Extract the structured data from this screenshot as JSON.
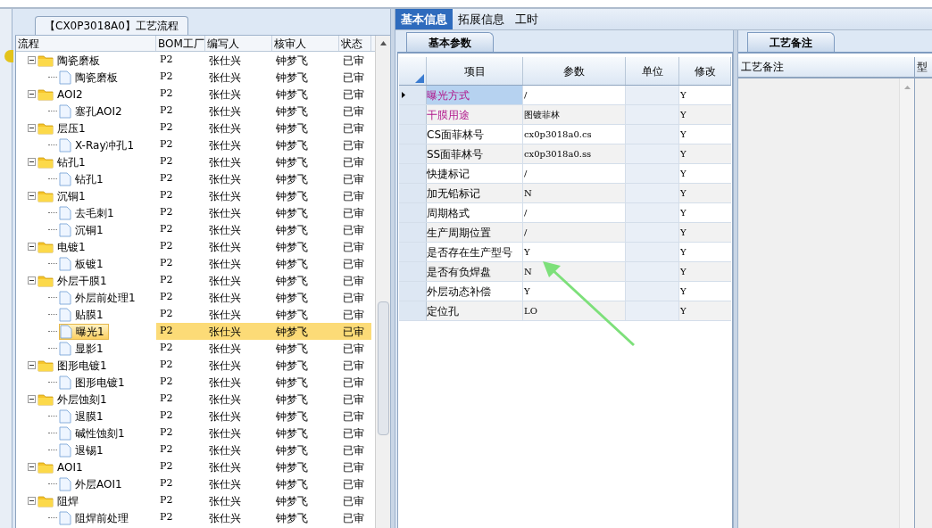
{
  "flow_panel": {
    "title": "【CX0P3018A0】工艺流程",
    "columns": [
      "流程",
      "BOM工厂",
      "编写人",
      "核审人",
      "状态"
    ],
    "tree": [
      {
        "label": "陶瓷磨板",
        "bom": "P2",
        "writer": "张仕兴",
        "reviewer": "钟梦飞",
        "status": "已审",
        "expanded": true,
        "selected": false,
        "children": [
          {
            "label": "陶瓷磨板",
            "bom": "P2",
            "writer": "张仕兴",
            "reviewer": "钟梦飞",
            "status": "已审",
            "selected": false
          }
        ]
      },
      {
        "label": "AOI2",
        "bom": "P2",
        "writer": "张仕兴",
        "reviewer": "钟梦飞",
        "status": "已审",
        "expanded": true,
        "selected": false,
        "children": [
          {
            "label": "塞孔AOI2",
            "bom": "P2",
            "writer": "张仕兴",
            "reviewer": "钟梦飞",
            "status": "已审",
            "selected": false
          }
        ]
      },
      {
        "label": "层压1",
        "bom": "P2",
        "writer": "张仕兴",
        "reviewer": "钟梦飞",
        "status": "已审",
        "expanded": true,
        "selected": false,
        "children": [
          {
            "label": "X-Ray冲孔1",
            "bom": "P2",
            "writer": "张仕兴",
            "reviewer": "钟梦飞",
            "status": "已审",
            "selected": false
          }
        ]
      },
      {
        "label": "钻孔1",
        "bom": "P2",
        "writer": "张仕兴",
        "reviewer": "钟梦飞",
        "status": "已审",
        "expanded": true,
        "selected": false,
        "children": [
          {
            "label": "钻孔1",
            "bom": "P2",
            "writer": "张仕兴",
            "reviewer": "钟梦飞",
            "status": "已审",
            "selected": false
          }
        ]
      },
      {
        "label": "沉铜1",
        "bom": "P2",
        "writer": "张仕兴",
        "reviewer": "钟梦飞",
        "status": "已审",
        "expanded": true,
        "selected": false,
        "children": [
          {
            "label": "去毛刺1",
            "bom": "P2",
            "writer": "张仕兴",
            "reviewer": "钟梦飞",
            "status": "已审",
            "selected": false
          },
          {
            "label": "沉铜1",
            "bom": "P2",
            "writer": "张仕兴",
            "reviewer": "钟梦飞",
            "status": "已审",
            "selected": false
          }
        ]
      },
      {
        "label": "电镀1",
        "bom": "P2",
        "writer": "张仕兴",
        "reviewer": "钟梦飞",
        "status": "已审",
        "expanded": true,
        "selected": false,
        "children": [
          {
            "label": "板镀1",
            "bom": "P2",
            "writer": "张仕兴",
            "reviewer": "钟梦飞",
            "status": "已审",
            "selected": false
          }
        ]
      },
      {
        "label": "外层干膜1",
        "bom": "P2",
        "writer": "张仕兴",
        "reviewer": "钟梦飞",
        "status": "已审",
        "expanded": true,
        "selected": false,
        "children": [
          {
            "label": "外层前处理1",
            "bom": "P2",
            "writer": "张仕兴",
            "reviewer": "钟梦飞",
            "status": "已审",
            "selected": false
          },
          {
            "label": "贴膜1",
            "bom": "P2",
            "writer": "张仕兴",
            "reviewer": "钟梦飞",
            "status": "已审",
            "selected": false
          },
          {
            "label": "曝光1",
            "bom": "P2",
            "writer": "张仕兴",
            "reviewer": "钟梦飞",
            "status": "已审",
            "selected": true
          },
          {
            "label": "显影1",
            "bom": "P2",
            "writer": "张仕兴",
            "reviewer": "钟梦飞",
            "status": "已审",
            "selected": false
          }
        ]
      },
      {
        "label": "图形电镀1",
        "bom": "P2",
        "writer": "张仕兴",
        "reviewer": "钟梦飞",
        "status": "已审",
        "expanded": true,
        "selected": false,
        "children": [
          {
            "label": "图形电镀1",
            "bom": "P2",
            "writer": "张仕兴",
            "reviewer": "钟梦飞",
            "status": "已审",
            "selected": false
          }
        ]
      },
      {
        "label": "外层蚀刻1",
        "bom": "P2",
        "writer": "张仕兴",
        "reviewer": "钟梦飞",
        "status": "已审",
        "expanded": true,
        "selected": false,
        "children": [
          {
            "label": "退膜1",
            "bom": "P2",
            "writer": "张仕兴",
            "reviewer": "钟梦飞",
            "status": "已审",
            "selected": false
          },
          {
            "label": "碱性蚀刻1",
            "bom": "P2",
            "writer": "张仕兴",
            "reviewer": "钟梦飞",
            "status": "已审",
            "selected": false
          },
          {
            "label": "退锡1",
            "bom": "P2",
            "writer": "张仕兴",
            "reviewer": "钟梦飞",
            "status": "已审",
            "selected": false
          }
        ]
      },
      {
        "label": "AOI1",
        "bom": "P2",
        "writer": "张仕兴",
        "reviewer": "钟梦飞",
        "status": "已审",
        "expanded": true,
        "selected": false,
        "children": [
          {
            "label": "外层AOI1",
            "bom": "P2",
            "writer": "张仕兴",
            "reviewer": "钟梦飞",
            "status": "已审",
            "selected": false
          }
        ]
      },
      {
        "label": "阻焊",
        "bom": "P2",
        "writer": "张仕兴",
        "reviewer": "钟梦飞",
        "status": "已审",
        "expanded": true,
        "selected": false,
        "children": [
          {
            "label": "阻焊前处理",
            "bom": "P2",
            "writer": "张仕兴",
            "reviewer": "钟梦飞",
            "status": "已审",
            "selected": false
          }
        ]
      }
    ]
  },
  "info_panel": {
    "tabs": [
      {
        "label": "基本信息",
        "selected": true
      },
      {
        "label": "拓展信息",
        "selected": false
      },
      {
        "label": "工时",
        "selected": false
      }
    ],
    "subtab": "基本参数",
    "columns": [
      "项目",
      "参数",
      "单位",
      "修改"
    ],
    "rows": [
      {
        "item": "曝光方式",
        "param": "/",
        "modify": "Y",
        "required": true,
        "selected": true
      },
      {
        "item": "干膜用途",
        "param": "图镀菲林",
        "modify": "Y",
        "required": true,
        "selected": false
      },
      {
        "item": "CS面菲林号",
        "param": "cx0p3018a0.cs",
        "modify": "Y",
        "required": false,
        "selected": false
      },
      {
        "item": "SS面菲林号",
        "param": "cx0p3018a0.ss",
        "modify": "Y",
        "required": false,
        "selected": false
      },
      {
        "item": "快捷标记",
        "param": "/",
        "modify": "Y",
        "required": false,
        "selected": false
      },
      {
        "item": "加无铅标记",
        "param": "N",
        "modify": "Y",
        "required": false,
        "selected": false
      },
      {
        "item": "周期格式",
        "param": "/",
        "modify": "Y",
        "required": false,
        "selected": false
      },
      {
        "item": "生产周期位置",
        "param": "/",
        "modify": "Y",
        "required": false,
        "selected": false
      },
      {
        "item": "是否存在生产型号",
        "param": "Y",
        "modify": "Y",
        "required": false,
        "selected": false
      },
      {
        "item": "是否有负焊盘",
        "param": "N",
        "modify": "Y",
        "required": false,
        "selected": false
      },
      {
        "item": "外层动态补偿",
        "param": "Y",
        "modify": "Y",
        "required": false,
        "selected": false
      },
      {
        "item": "定位孔",
        "param": "LO",
        "modify": "Y",
        "required": false,
        "selected": false
      }
    ]
  },
  "notes_panel": {
    "subtab": "工艺备注",
    "columns": [
      "工艺备注",
      "型"
    ]
  }
}
